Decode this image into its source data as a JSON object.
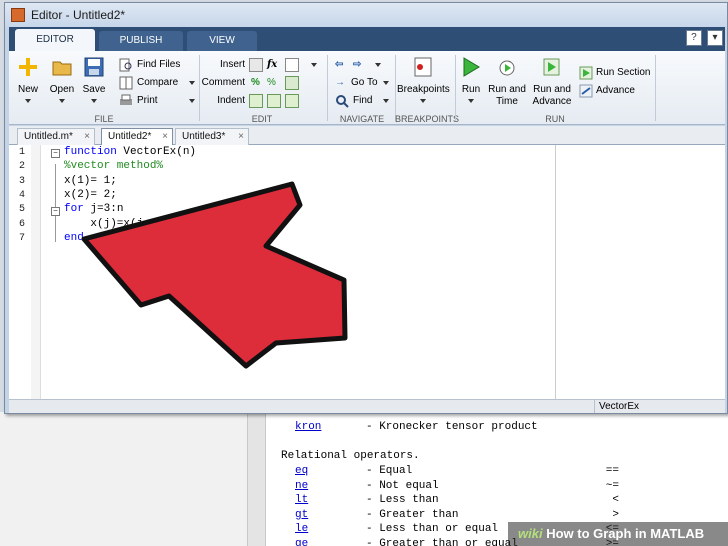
{
  "window": {
    "title": "Editor - Untitled2*"
  },
  "ribbon_tabs": [
    {
      "label": "EDITOR",
      "active": true
    },
    {
      "label": "PUBLISH",
      "active": false
    },
    {
      "label": "VIEW",
      "active": false
    }
  ],
  "window_buttons": [
    "?",
    "▾"
  ],
  "ribbon": {
    "file": {
      "group_label": "FILE",
      "new": "New",
      "open": "Open",
      "save": "Save",
      "find_files": "Find Files",
      "compare": "Compare",
      "print": "Print"
    },
    "edit": {
      "group_label": "EDIT",
      "insert": "Insert",
      "comment": "Comment",
      "indent": "Indent"
    },
    "navigate": {
      "group_label": "NAVIGATE",
      "go_to": "Go To",
      "find": "Find"
    },
    "breakpoints": {
      "group_label": "BREAKPOINTS",
      "breakpoints": "Breakpoints"
    },
    "run": {
      "group_label": "RUN",
      "run": "Run",
      "run_and_time_1": "Run and",
      "run_and_time_2": "Time",
      "run_and_advance_1": "Run and",
      "run_and_advance_2": "Advance",
      "run_section": "Run Section",
      "advance": "Advance"
    }
  },
  "file_tabs": [
    {
      "label": "Untitled.m*",
      "active": false
    },
    {
      "label": "Untitled2*",
      "active": true
    },
    {
      "label": "Untitled3*",
      "active": false
    }
  ],
  "code_lines": [
    {
      "n": "1",
      "parts": [
        [
          "kw",
          "function"
        ],
        [
          "",
          " VectorEx(n)"
        ]
      ]
    },
    {
      "n": "2",
      "parts": [
        [
          "cm",
          "%vector method%"
        ]
      ]
    },
    {
      "n": "3",
      "parts": [
        [
          "",
          "x(1)= 1;"
        ]
      ]
    },
    {
      "n": "4",
      "parts": [
        [
          "",
          "x(2)= 2;"
        ]
      ]
    },
    {
      "n": "5",
      "parts": [
        [
          "kw",
          "for"
        ],
        [
          "",
          " j=3:n"
        ]
      ]
    },
    {
      "n": "6",
      "parts": [
        [
          "",
          "    x(j)=x(j"
        ]
      ]
    },
    {
      "n": "7",
      "parts": [
        [
          "kw",
          "end"
        ]
      ]
    }
  ],
  "status": {
    "function_name": "VectorEx"
  },
  "help": {
    "kron": {
      "link": "kron",
      "desc": "- Kronecker tensor product"
    },
    "section": "Relational operators.",
    "operators": [
      {
        "link": "eq",
        "desc": "- Equal",
        "sym": "=="
      },
      {
        "link": "ne",
        "desc": "- Not equal",
        "sym": "~="
      },
      {
        "link": "lt",
        "desc": "- Less than",
        "sym": "<"
      },
      {
        "link": "gt",
        "desc": "- Greater than",
        "sym": ">"
      },
      {
        "link": "le",
        "desc": "- Less than or equal",
        "sym": "<="
      },
      {
        "link": "ge",
        "desc": "- Greater than or equal",
        "sym": ">="
      }
    ]
  },
  "watermark": {
    "brand": "wiki",
    "text": "How to Graph in MATLAB"
  },
  "colors": {
    "arrow_fill": "#dd2c3a",
    "arrow_stroke": "#111111",
    "ribbon_dark": "#2f4e75",
    "keyword": "#0000ff",
    "comment": "#228b22"
  }
}
